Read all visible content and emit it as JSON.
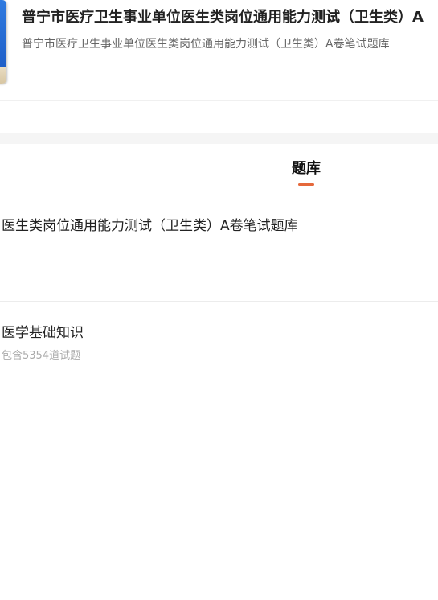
{
  "header": {
    "book_title": "普宁市医疗卫生事业单位医生类岗位通用能力测试（卫生类）A",
    "book_subtitle": "普宁市医疗卫生事业单位医生类岗位通用能力测试（卫生类）A卷笔试题库"
  },
  "tabs": [
    {
      "label": "题库"
    }
  ],
  "bank": {
    "title": "医生类岗位通用能力测试（卫生类）A卷笔试题库"
  },
  "sections": [
    {
      "name": "医学基础知识",
      "count_text": "包含5354道试题"
    }
  ]
}
